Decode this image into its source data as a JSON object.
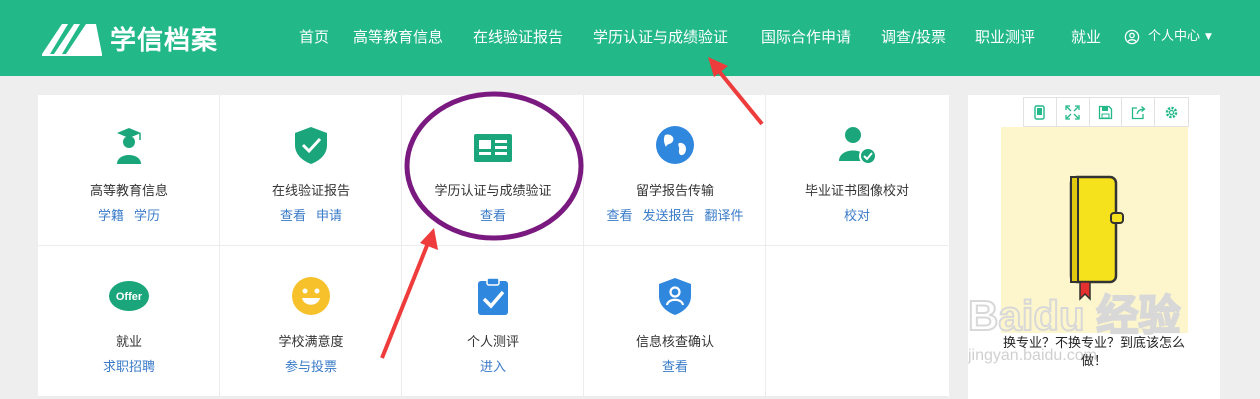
{
  "header": {
    "logo_text": "学信档案",
    "nav": [
      {
        "label": "首页"
      },
      {
        "label": "高等教育信息"
      },
      {
        "label": "在线验证报告"
      },
      {
        "label": "学历认证与成绩验证"
      },
      {
        "label": "国际合作申请"
      },
      {
        "label": "调查/投票"
      },
      {
        "label": "职业测评"
      },
      {
        "label": "就业"
      }
    ],
    "user_menu_label": "个人中心"
  },
  "services": [
    {
      "title": "高等教育信息",
      "links": [
        "学籍",
        "学历"
      ],
      "icon": "graduate-icon"
    },
    {
      "title": "在线验证报告",
      "links": [
        "查看",
        "申请"
      ],
      "icon": "shield-check-icon"
    },
    {
      "title": "学历认证与成绩验证",
      "links": [
        "查看"
      ],
      "icon": "certificate-card-icon"
    },
    {
      "title": "留学报告传输",
      "links": [
        "查看",
        "发送报告",
        "翻译件"
      ],
      "icon": "globe-icon"
    },
    {
      "title": "毕业证书图像校对",
      "links": [
        "校对"
      ],
      "icon": "user-check-icon"
    },
    {
      "title": "就业",
      "links": [
        "求职招聘"
      ],
      "icon": "offer-icon",
      "icon_text": "Offer"
    },
    {
      "title": "学校满意度",
      "links": [
        "参与投票"
      ],
      "icon": "smiley-icon"
    },
    {
      "title": "个人测评",
      "links": [
        "进入"
      ],
      "icon": "clipboard-check-icon"
    },
    {
      "title": "信息核查确认",
      "links": [
        "查看"
      ],
      "icon": "shield-user-icon"
    }
  ],
  "side": {
    "toolbar_icons": [
      "phone-icon",
      "fullscreen-icon",
      "save-icon",
      "share-icon",
      "settings-icon"
    ],
    "caption": "换专业？不换专业？到底该怎么做！",
    "watermark_text": "Baidu 经验",
    "watermark_url": "jingyan.baidu.com"
  },
  "colors": {
    "brand_green": "#22b888",
    "link_blue": "#3a7bc8",
    "annotation_purple": "#7a1a80",
    "annotation_red": "#ee3b3b"
  }
}
